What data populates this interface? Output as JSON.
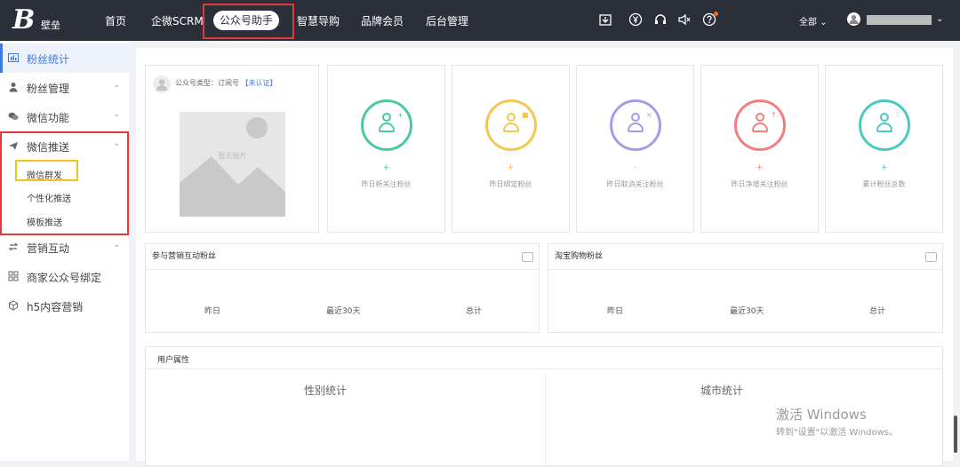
{
  "topbar": {
    "logo_letter": "B",
    "logo_text": "壁垒",
    "nav": [
      "首页",
      "企微SCRM",
      "公众号助手",
      "智慧导购",
      "品牌会员",
      "后台管理"
    ],
    "icons": [
      "download-icon",
      "yen-icon",
      "headset-icon",
      "speaker-icon",
      "help-icon"
    ],
    "scope_label": "全部",
    "scope_chevron": "⌄",
    "user_chevron": "⌄",
    "notice_color": "#ff6a00"
  },
  "sidebar": {
    "items": [
      {
        "label": "粉丝统计",
        "icon": "bar-chart-icon"
      },
      {
        "label": "粉丝管理",
        "icon": "user-icon"
      },
      {
        "label": "微信功能",
        "icon": "wechat-icon"
      },
      {
        "label": "微信推送",
        "icon": "plane-icon"
      },
      {
        "label": "营销互动",
        "icon": "swap-icon"
      },
      {
        "label": "商家公众号绑定",
        "icon": "grid-icon"
      },
      {
        "label": "h5内容营销",
        "icon": "cube-icon"
      }
    ],
    "sub_items": [
      "微信群发",
      "个性化推送",
      "模板推送"
    ],
    "chevron": "⌄",
    "accent": "#3d7be0"
  },
  "account": {
    "type_label": "公众号类型：",
    "type_value": "订阅号",
    "verify_label": "【未认证】",
    "image_placeholder": "暂无图片"
  },
  "stats": [
    {
      "label": "昨日新关注粉丝",
      "value": "+",
      "color": "#4cc9a0"
    },
    {
      "label": "昨日绑定粉丝",
      "value": "+",
      "color": "#f2c94c"
    },
    {
      "label": "昨日取消关注粉丝",
      "value": "-",
      "color": "#a89be8"
    },
    {
      "label": "昨日净增关注粉丝",
      "value": "+",
      "color": "#f08080"
    },
    {
      "label": "累计粉丝总数",
      "value": "+",
      "color": "#4cc9c0"
    }
  ],
  "panels": [
    {
      "title": "参与营销互动粉丝",
      "cols": [
        "昨日",
        "最近30天",
        "总计"
      ]
    },
    {
      "title": "淘宝购物粉丝",
      "cols": [
        "昨日",
        "最近30天",
        "总计"
      ]
    }
  ],
  "user_attr": {
    "title": "用户属性",
    "gender": "性别统计",
    "city": "城市统计"
  },
  "watermark": {
    "line1": "激活 Windows",
    "line2": "转到\"设置\"以激活 Windows。"
  }
}
